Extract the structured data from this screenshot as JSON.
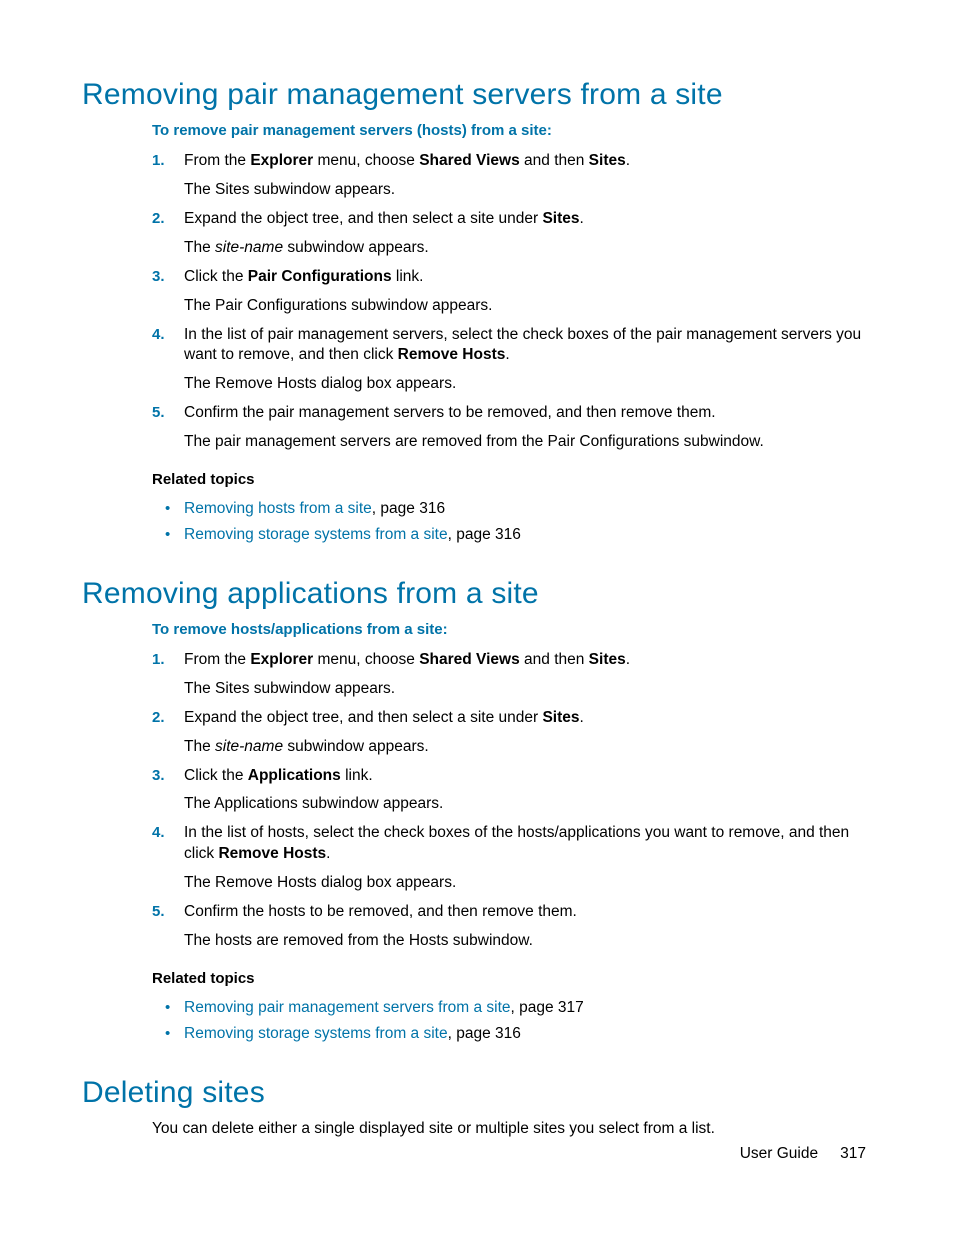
{
  "sec1": {
    "heading": "Removing pair management servers from a site",
    "procLabel": "To remove pair management servers (hosts) from a site:",
    "steps": [
      {
        "t1a": "From the ",
        "t1b": "Explorer",
        "t1c": " menu, choose ",
        "t1d": "Shared Views",
        "t1e": " and then ",
        "t1f": "Sites",
        "t1g": ".",
        "t2": "The Sites subwindow appears."
      },
      {
        "t1a": "Expand the object tree, and then select a site under ",
        "t1b": "Sites",
        "t1c": ".",
        "t2a": "The ",
        "t2b": "site-name",
        "t2c": " subwindow appears."
      },
      {
        "t1a": "Click the ",
        "t1b": "Pair Configurations",
        "t1c": " link.",
        "t2": "The Pair Configurations subwindow appears."
      },
      {
        "t1a": "In the list of pair management servers, select the check boxes of the pair management servers you want to remove, and then click ",
        "t1b": "Remove Hosts",
        "t1c": ".",
        "t2": "The Remove Hosts dialog box appears."
      },
      {
        "t1": "Confirm the pair management servers to be removed, and then remove them.",
        "t2": "The pair management servers are removed from the Pair Configurations subwindow."
      }
    ],
    "relatedHeading": "Related topics",
    "related": [
      {
        "link": "Removing hosts from a site",
        "suffix": ", page 316"
      },
      {
        "link": "Removing storage systems from a site",
        "suffix": ", page 316"
      }
    ]
  },
  "sec2": {
    "heading": "Removing applications from a site",
    "procLabel": "To remove hosts/applications from a site:",
    "steps": [
      {
        "t1a": "From the ",
        "t1b": "Explorer",
        "t1c": " menu, choose ",
        "t1d": "Shared Views",
        "t1e": " and then ",
        "t1f": "Sites",
        "t1g": ".",
        "t2": "The Sites subwindow appears."
      },
      {
        "t1a": "Expand the object tree, and then select a site under ",
        "t1b": "Sites",
        "t1c": ".",
        "t2a": "The ",
        "t2b": "site-name",
        "t2c": " subwindow appears."
      },
      {
        "t1a": "Click the ",
        "t1b": "Applications",
        "t1c": " link.",
        "t2": "The Applications subwindow appears."
      },
      {
        "t1a": "In the list of hosts, select the check boxes of the hosts/applications you want to remove, and then click ",
        "t1b": "Remove Hosts",
        "t1c": ".",
        "t2": "The Remove Hosts dialog box appears."
      },
      {
        "t1": "Confirm the hosts to be removed, and then remove them.",
        "t2": "The hosts are removed from the Hosts subwindow."
      }
    ],
    "relatedHeading": "Related topics",
    "related": [
      {
        "link": "Removing pair management servers from a site",
        "suffix": ", page 317"
      },
      {
        "link": "Removing storage systems from a site",
        "suffix": ", page 316"
      }
    ]
  },
  "sec3": {
    "heading": "Deleting sites",
    "intro": "You can delete either a single displayed site or multiple sites you select from a list."
  },
  "footer": {
    "label": "User Guide",
    "page": "317"
  }
}
